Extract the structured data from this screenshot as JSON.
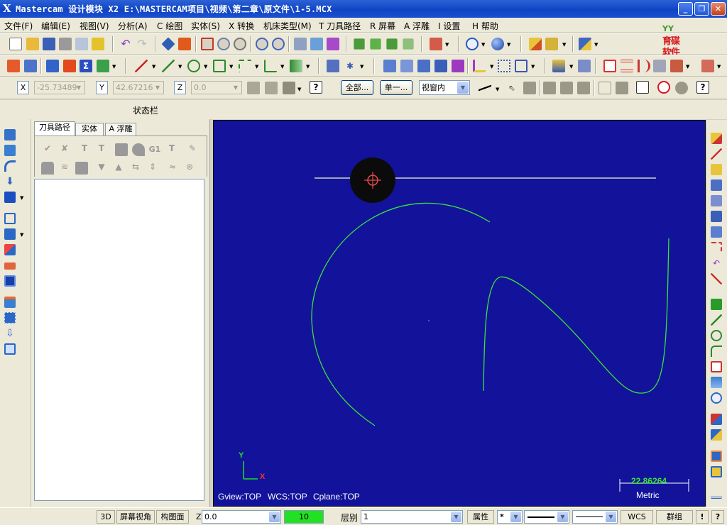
{
  "title_bar": {
    "title": "Mastercam 设计模块  X2  E:\\MASTERCAM项目\\视频\\第二章\\原文件\\1-5.MCX",
    "icon": "X",
    "minimize": "_",
    "maximize": "❐",
    "close": "✕"
  },
  "menu": {
    "items": [
      "文件(F)",
      "编辑(E)",
      "视图(V)",
      "分析(A)",
      "C 绘图",
      "实体(S)",
      "X 转换",
      "机床类型(M)",
      "T 刀具路径",
      "R 屏幕",
      "A 浮雕",
      "I 设置",
      "H 帮助"
    ]
  },
  "logo": {
    "top": "YY",
    "line1": "育碟",
    "line2": "软件"
  },
  "coords": {
    "x_label": "X",
    "x_value": "-25.73489",
    "y_label": "Y",
    "y_value": "42.67216",
    "z_label": "Z",
    "z_value": "0.0",
    "all_button": "全部...",
    "single_button": "单一...",
    "view_select": "视窗内"
  },
  "status_label": "状态栏",
  "manager": {
    "tabs": [
      "刀具路径",
      "实体",
      "A 浮雕"
    ]
  },
  "viewport": {
    "axis_y": "Y",
    "axis_x": "X",
    "gview": "Gview:TOP",
    "wcs": "WCS:TOP",
    "cplane": "Cplane:TOP",
    "scale_value": "22.86264",
    "scale_units": "Metric",
    "background": "#12139a",
    "geometry_color": "#3ce03c"
  },
  "bottom": {
    "btn_3d": "3D",
    "screen_view": "屏幕视角",
    "construct_plane": "构图面",
    "z_label": "Z",
    "z_value": "0.0",
    "color_value": "10",
    "level_label": "层别",
    "level_value": "1",
    "attr_button": "属性",
    "wcs_button": "WCS",
    "group_button": "群组",
    "help_button": "!",
    "q_button": "?"
  }
}
